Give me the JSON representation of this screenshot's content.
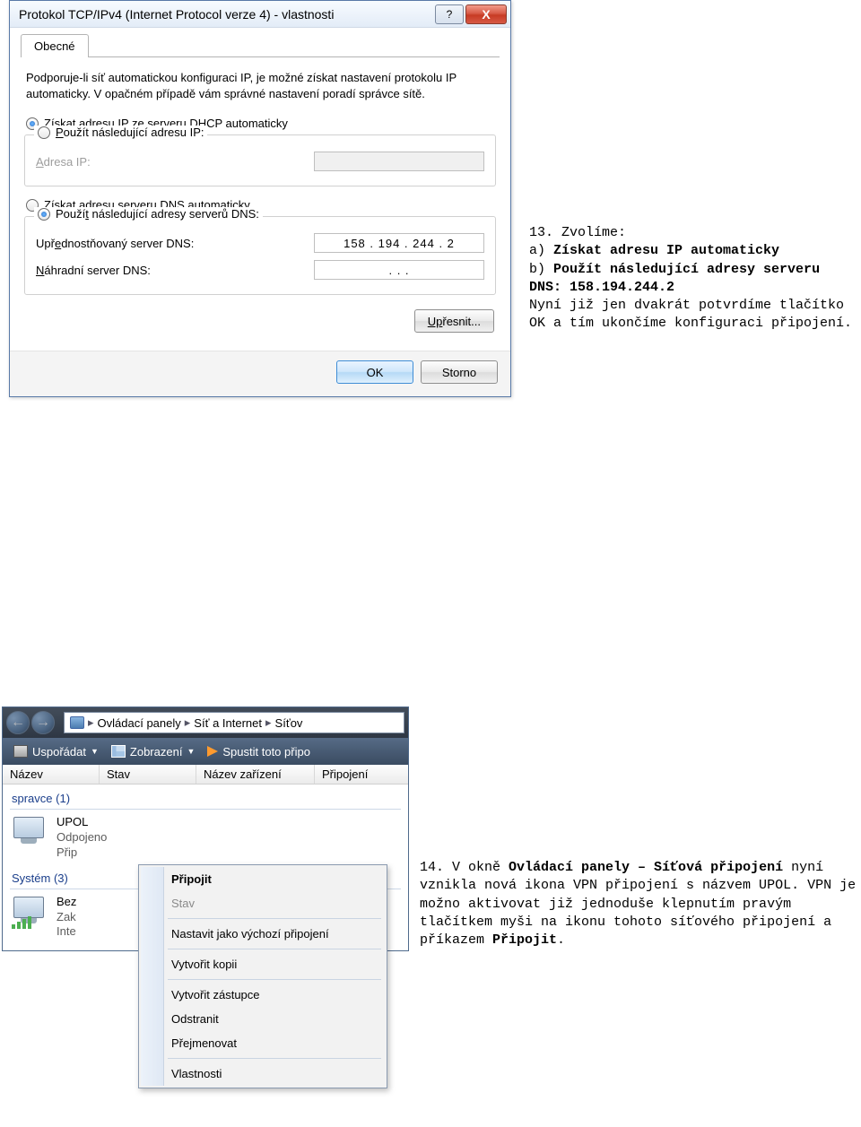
{
  "dialog1": {
    "title": "Protokol TCP/IPv4 (Internet Protocol verze 4) - vlastnosti",
    "help_symbol": "?",
    "close_symbol": "X",
    "tab": "Obecné",
    "intro": "Podporuje-li síť automatickou konfiguraci IP, je možné získat nastavení protokolu IP automaticky. V opačném případě vám správné nastavení poradí správce sítě.",
    "r_ip_auto_pre": "Z",
    "r_ip_auto_post": "ískat adresu IP ze serveru DHCP automaticky",
    "r_ip_manual_pre": "P",
    "r_ip_manual_post": "oužít následující adresu IP:",
    "ip_addr_label_pre": "A",
    "ip_addr_label_post": "dresa IP:",
    "r_dns_auto": "Získat adresu serveru DNS automaticky",
    "r_dns_manual_pre": "Použí",
    "r_dns_manual_mn": "t",
    "r_dns_manual_post": " následující adresy serverů DNS:",
    "dns_pref_pre": "Upř",
    "dns_pref_mn": "e",
    "dns_pref_post": "dnostňovaný server DNS:",
    "dns_pref_value": "158 . 194 . 244 .   2",
    "dns_alt_pre": "N",
    "dns_alt_post": "áhradní server DNS:",
    "dns_alt_value": ".       .       .",
    "btn_advanced_pre": "Up",
    "btn_advanced_post": "řesnit...",
    "btn_ok": "OK",
    "btn_cancel": "Storno"
  },
  "text13": {
    "l1": "13. Zvolíme:",
    "l2a": "a) ",
    "l2b": "Získat adresu IP automaticky",
    "l3a": "b) ",
    "l3b": "Použít následující adresy serveru DNS: 158.194.244.2",
    "l4": "Nyní již jen dvakrát potvrdíme tlačítko OK a tím ukončíme konfiguraci připojení."
  },
  "explorer": {
    "addr": {
      "p1": "Ovládací panely",
      "p2": "Síť a Internet",
      "p3": "Síťov"
    },
    "toolbar": {
      "org": "Uspořádat",
      "view": "Zobrazení",
      "run": "Spustit toto připo"
    },
    "cols": {
      "c1": "Název",
      "c2": "Stav",
      "c3": "Název zařízení",
      "c4": "Připojení"
    },
    "group1": "spravce (1)",
    "conn1": {
      "name": "UPOL",
      "state": "Odpojeno",
      "type": "Přip"
    },
    "group2": "Systém (3)",
    "conn2": {
      "name": "Bez",
      "state": "Zak",
      "type": "Inte"
    }
  },
  "ctxmenu": {
    "i1": "Připojit",
    "i2": "Stav",
    "i3": "Nastavit jako výchozí připojení",
    "i4": "Vytvořit kopii",
    "i5": "Vytvořit zástupce",
    "i6": "Odstranit",
    "i7": "Přejmenovat",
    "i8": "Vlastnosti"
  },
  "text14": {
    "pre1": "14. V okně ",
    "b1": "Ovládací panely – Síťová připojení",
    "mid1": " nyní vznikla nová ikona VPN připojení s názvem UPOL. VPN je možno aktivovat již jednoduše klepnutím pravým tlačítkem myši na ikonu tohoto síťového připojení a příkazem ",
    "b2": "Připojit",
    "post": "."
  }
}
